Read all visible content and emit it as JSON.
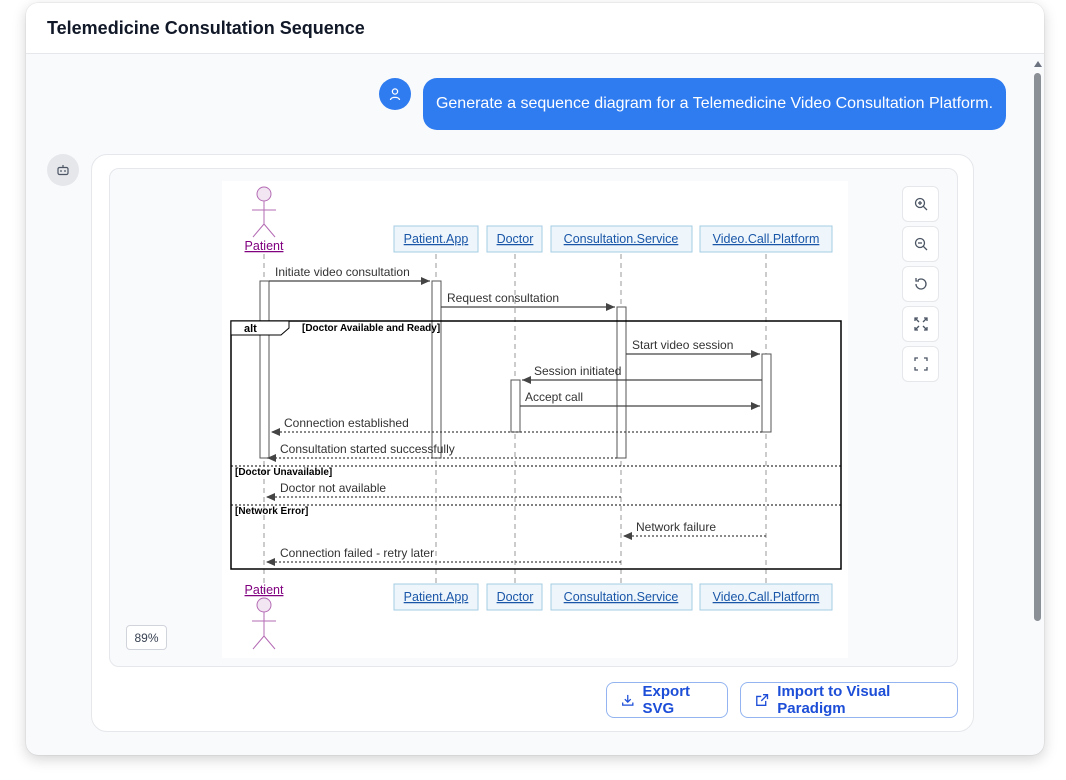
{
  "window": {
    "title": "Telemedicine Consultation Sequence"
  },
  "user_message": "Generate a sequence diagram for a Telemedicine Video Consultation Platform.",
  "diagram": {
    "participants": {
      "patient": "Patient",
      "patient_app": "Patient.App",
      "doctor": "Doctor",
      "consultation_service": "Consultation.Service",
      "video_call_platform": "Video.Call.Platform"
    },
    "fragment": {
      "keyword": "alt",
      "condition_1": "[Doctor Available and Ready]",
      "condition_2": "[Doctor Unavailable]",
      "condition_3": "[Network Error]"
    },
    "messages": {
      "m1": "Initiate video consultation",
      "m2": "Request consultation",
      "m3": "Start video session",
      "m4": "Session initiated",
      "m5": "Accept call",
      "m6": "Connection established",
      "m7": "Consultation started successfully",
      "m8": "Doctor not available",
      "m9": "Network failure",
      "m10": "Connection failed - retry later"
    }
  },
  "zoom": {
    "level": "89%"
  },
  "actions": {
    "export_label": "Export SVG",
    "import_label": "Import to Visual Paradigm"
  },
  "icons": {
    "zoom_in": "zoom-in-icon",
    "zoom_out": "zoom-out-icon",
    "reset": "reset-icon",
    "fit": "fit-icon",
    "fullscreen": "fullscreen-icon",
    "user": "user-icon",
    "bot": "bot-icon",
    "download": "download-icon",
    "external": "external-link-icon"
  },
  "colors": {
    "accent": "#2f7bf0",
    "participant_fill": "#eef6fb",
    "participant_border": "#a4cde3",
    "actor": "#800080"
  }
}
